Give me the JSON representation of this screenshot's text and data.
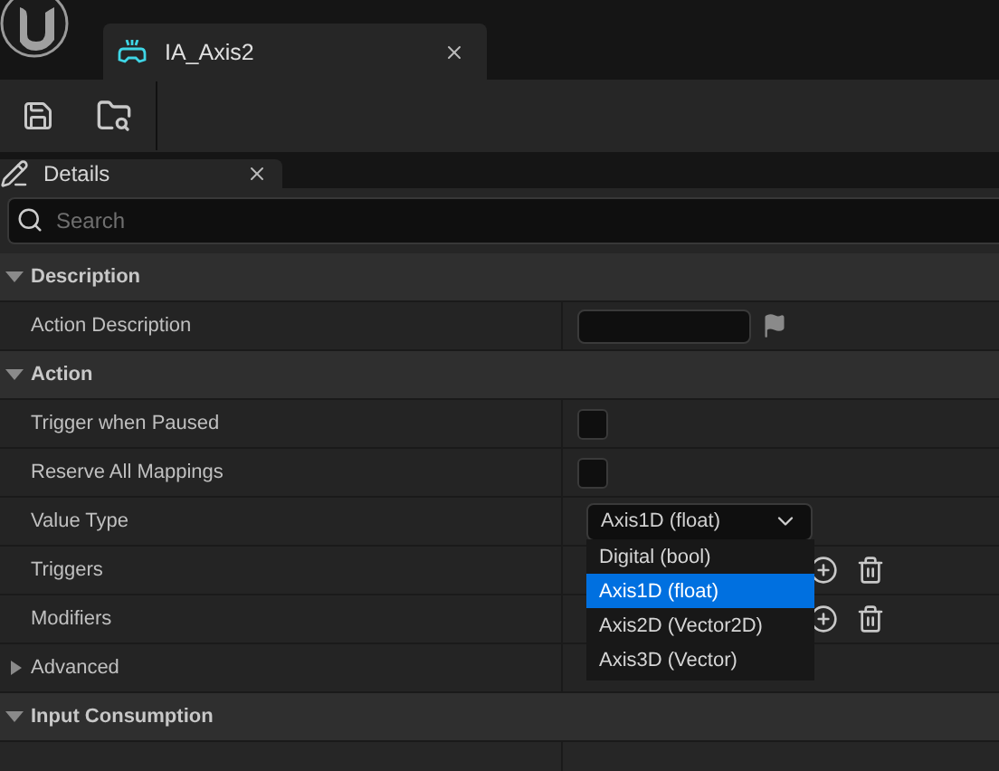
{
  "document_tab": {
    "title": "IA_Axis2"
  },
  "panel_tab": {
    "title": "Details"
  },
  "search": {
    "placeholder": "Search"
  },
  "sections": [
    {
      "title": "Description",
      "expanded": true,
      "rows": [
        {
          "label": "Action Description",
          "kind": "text"
        }
      ]
    },
    {
      "title": "Action",
      "expanded": true,
      "rows": [
        {
          "label": "Trigger when Paused",
          "kind": "checkbox",
          "checked": false
        },
        {
          "label": "Reserve All Mappings",
          "kind": "checkbox",
          "checked": false
        },
        {
          "label": "Value Type",
          "kind": "dropdown",
          "value": "Axis1D (float)",
          "expanded": true,
          "options": [
            {
              "label": "Digital (bool)",
              "selected": false
            },
            {
              "label": "Axis1D (float)",
              "selected": true
            },
            {
              "label": "Axis2D (Vector2D)",
              "selected": false
            },
            {
              "label": "Axis3D (Vector)",
              "selected": false
            }
          ]
        },
        {
          "label": "Triggers",
          "kind": "array"
        },
        {
          "label": "Modifiers",
          "kind": "array"
        },
        {
          "label": "Advanced",
          "kind": "group",
          "expanded": false
        }
      ]
    },
    {
      "title": "Input Consumption",
      "expanded": true
    }
  ]
}
